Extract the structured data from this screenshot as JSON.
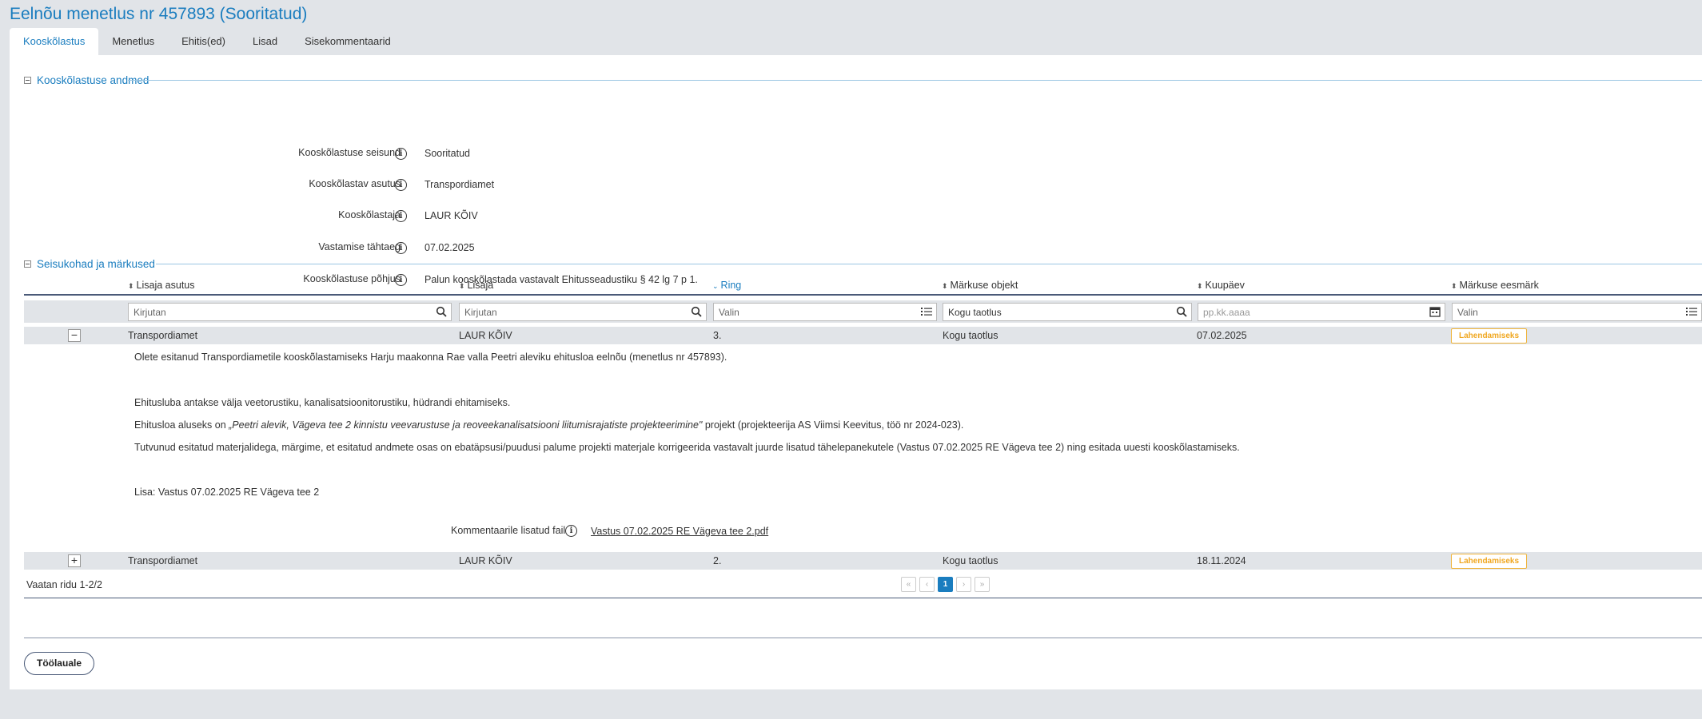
{
  "page_title": "Eelnõu menetlus nr 457893 (Sooritatud)",
  "tabs": [
    {
      "label": "Kooskõlastus",
      "active": true
    },
    {
      "label": "Menetlus"
    },
    {
      "label": "Ehitis(ed)"
    },
    {
      "label": "Lisad"
    },
    {
      "label": "Sisekommentaarid"
    }
  ],
  "details_section": {
    "title": "Kooskõlastuse andmed",
    "fields": [
      {
        "label": "Kooskõlastuse seisund",
        "value": "Sooritatud"
      },
      {
        "label": "Kooskõlastav asutus",
        "value": "Transpordiamet"
      },
      {
        "label": "Kooskõlastaja",
        "value": "LAUR KÕIV"
      },
      {
        "label": "Vastamise tähtaeg",
        "value": "07.02.2025"
      },
      {
        "label": "Kooskõlastuse põhjus",
        "value": "Palun kooskõlastada vastavalt Ehitusseadustiku § 42 lg 7 p 1."
      }
    ]
  },
  "remarks_section": {
    "title": "Seisukohad ja märkused",
    "columns": [
      {
        "label": "Lisaja asutus"
      },
      {
        "label": "Lisaja"
      },
      {
        "label": "Ring",
        "sorted": true
      },
      {
        "label": "Märkuse objekt"
      },
      {
        "label": "Kuupäev"
      },
      {
        "label": "Märkuse eesmärk"
      }
    ],
    "filters": [
      {
        "placeholder": "Kirjutan",
        "icon": "search-icon"
      },
      {
        "placeholder": "Kirjutan",
        "icon": "search-icon"
      },
      {
        "placeholder": "Valin",
        "icon": "list-icon"
      },
      {
        "value": "Kogu taotlus",
        "icon": "search-icon"
      },
      {
        "placeholder": "pp.kk.aaaa",
        "icon": "calendar-icon"
      },
      {
        "placeholder": "Valin",
        "icon": "list-icon"
      }
    ],
    "rows": [
      {
        "toggle": "−",
        "cells": [
          "Transpordiamet",
          "LAUR KÕIV",
          "3.",
          "Kogu taotlus",
          "07.02.2025"
        ],
        "badge": "Lahendamiseks",
        "expanded": true
      },
      {
        "toggle": "+",
        "cells": [
          "Transpordiamet",
          "LAUR KÕIV",
          "2.",
          "Kogu taotlus",
          "18.11.2024"
        ],
        "badge": "Lahendamiseks",
        "expanded": false
      }
    ],
    "detail": {
      "p1": "Olete esitanud Transpordiametile kooskõlastamiseks Harju maakonna Rae valla Peetri aleviku ehitusloa eelnõu (menetlus nr 457893).",
      "p2": "Ehitusluba antakse välja veetorustiku, kanalisatsioonitorustiku, hüdrandi ehitamiseks.",
      "p3_prefix": "Ehitusloa aluseks on ",
      "p3_italic": "„Peetri alevik, Vägeva tee 2 kinnistu veevarustuse ja reoveekanalisatsiooni liitumisrajatiste projekteerimine\"",
      "p3_suffix": " projekt (projekteerija AS Viimsi Keevitus, töö nr 2024-023).",
      "p4": "Tutvunud esitatud materjalidega, märgime, et esitatud andmete osas on ebatäpsusi/puudusi palume projekti materjale korrigeerida vastavalt juurde lisatud tähelepanekutele (Vastus 07.02.2025 RE Vägeva tee 2) ning esitada uuesti kooskõlastamiseks.",
      "p5": "Lisa: Vastus 07.02.2025 RE Vägeva tee 2",
      "attachment_label": "Kommentaarile lisatud fail",
      "attachment_link": "Vastus 07.02.2025 RE Vägeva tee 2.pdf"
    },
    "footer_info": "Vaatan ridu 1-2/2",
    "pager": {
      "first": "«",
      "prev": "‹",
      "current": "1",
      "next": "›",
      "last": "»"
    }
  },
  "back_button": "Töölauale",
  "colors": {
    "accent": "#1a7dbf",
    "badge": "#f0a720",
    "panel_bg": "#e1e4e8"
  }
}
